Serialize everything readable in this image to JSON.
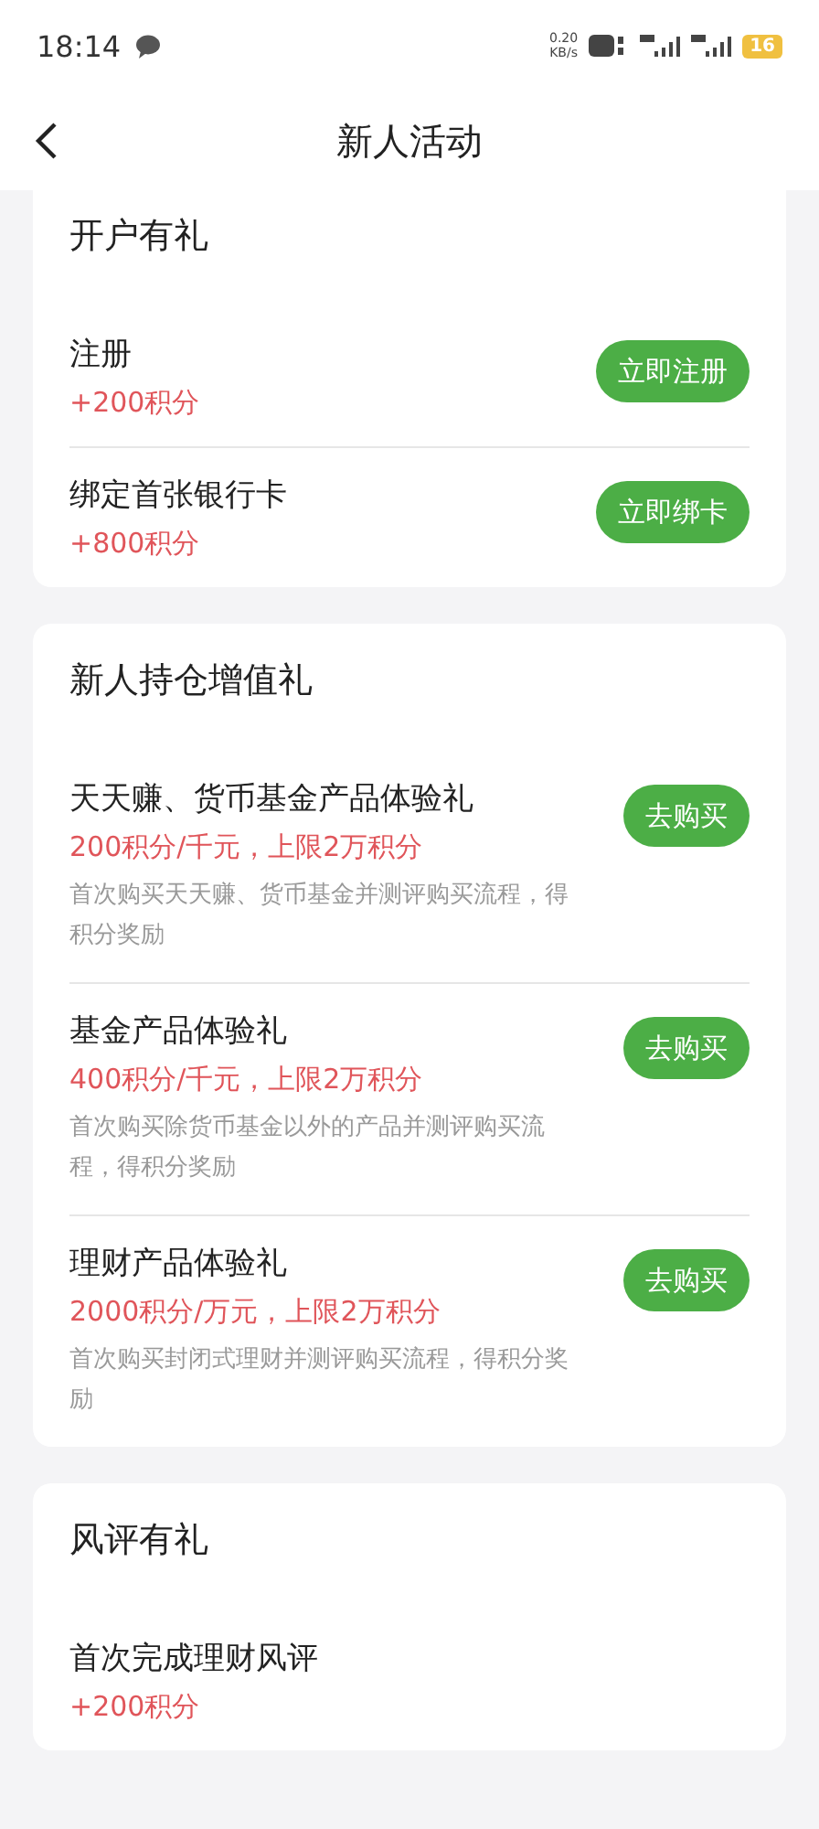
{
  "status_bar": {
    "time": "18:14",
    "net_speed": "0.20",
    "net_unit": "KB/s",
    "battery": "16"
  },
  "header": {
    "title": "新人活动"
  },
  "sections": [
    {
      "title": "开户有礼",
      "items": [
        {
          "title": "注册",
          "points": "+200积分",
          "button": "立即注册"
        },
        {
          "title": "绑定首张银行卡",
          "points": "+800积分",
          "button": "立即绑卡"
        }
      ]
    },
    {
      "title": "新人持仓增值礼",
      "items": [
        {
          "title": "天天赚、货币基金产品体验礼",
          "points": "200积分/千元，上限2万积分",
          "desc": "首次购买天天赚、货币基金并测评购买流程，得积分奖励",
          "button": "去购买"
        },
        {
          "title": "基金产品体验礼",
          "points": "400积分/千元，上限2万积分",
          "desc": "首次购买除货币基金以外的产品并测评购买流程，得积分奖励",
          "button": "去购买"
        },
        {
          "title": "理财产品体验礼",
          "points": "2000积分/万元，上限2万积分",
          "desc": "首次购买封闭式理财并测评购买流程，得积分奖励",
          "button": "去购买"
        }
      ]
    },
    {
      "title": "风评有礼",
      "items": [
        {
          "title": "首次完成理财风评",
          "points": "+200积分"
        }
      ]
    }
  ]
}
